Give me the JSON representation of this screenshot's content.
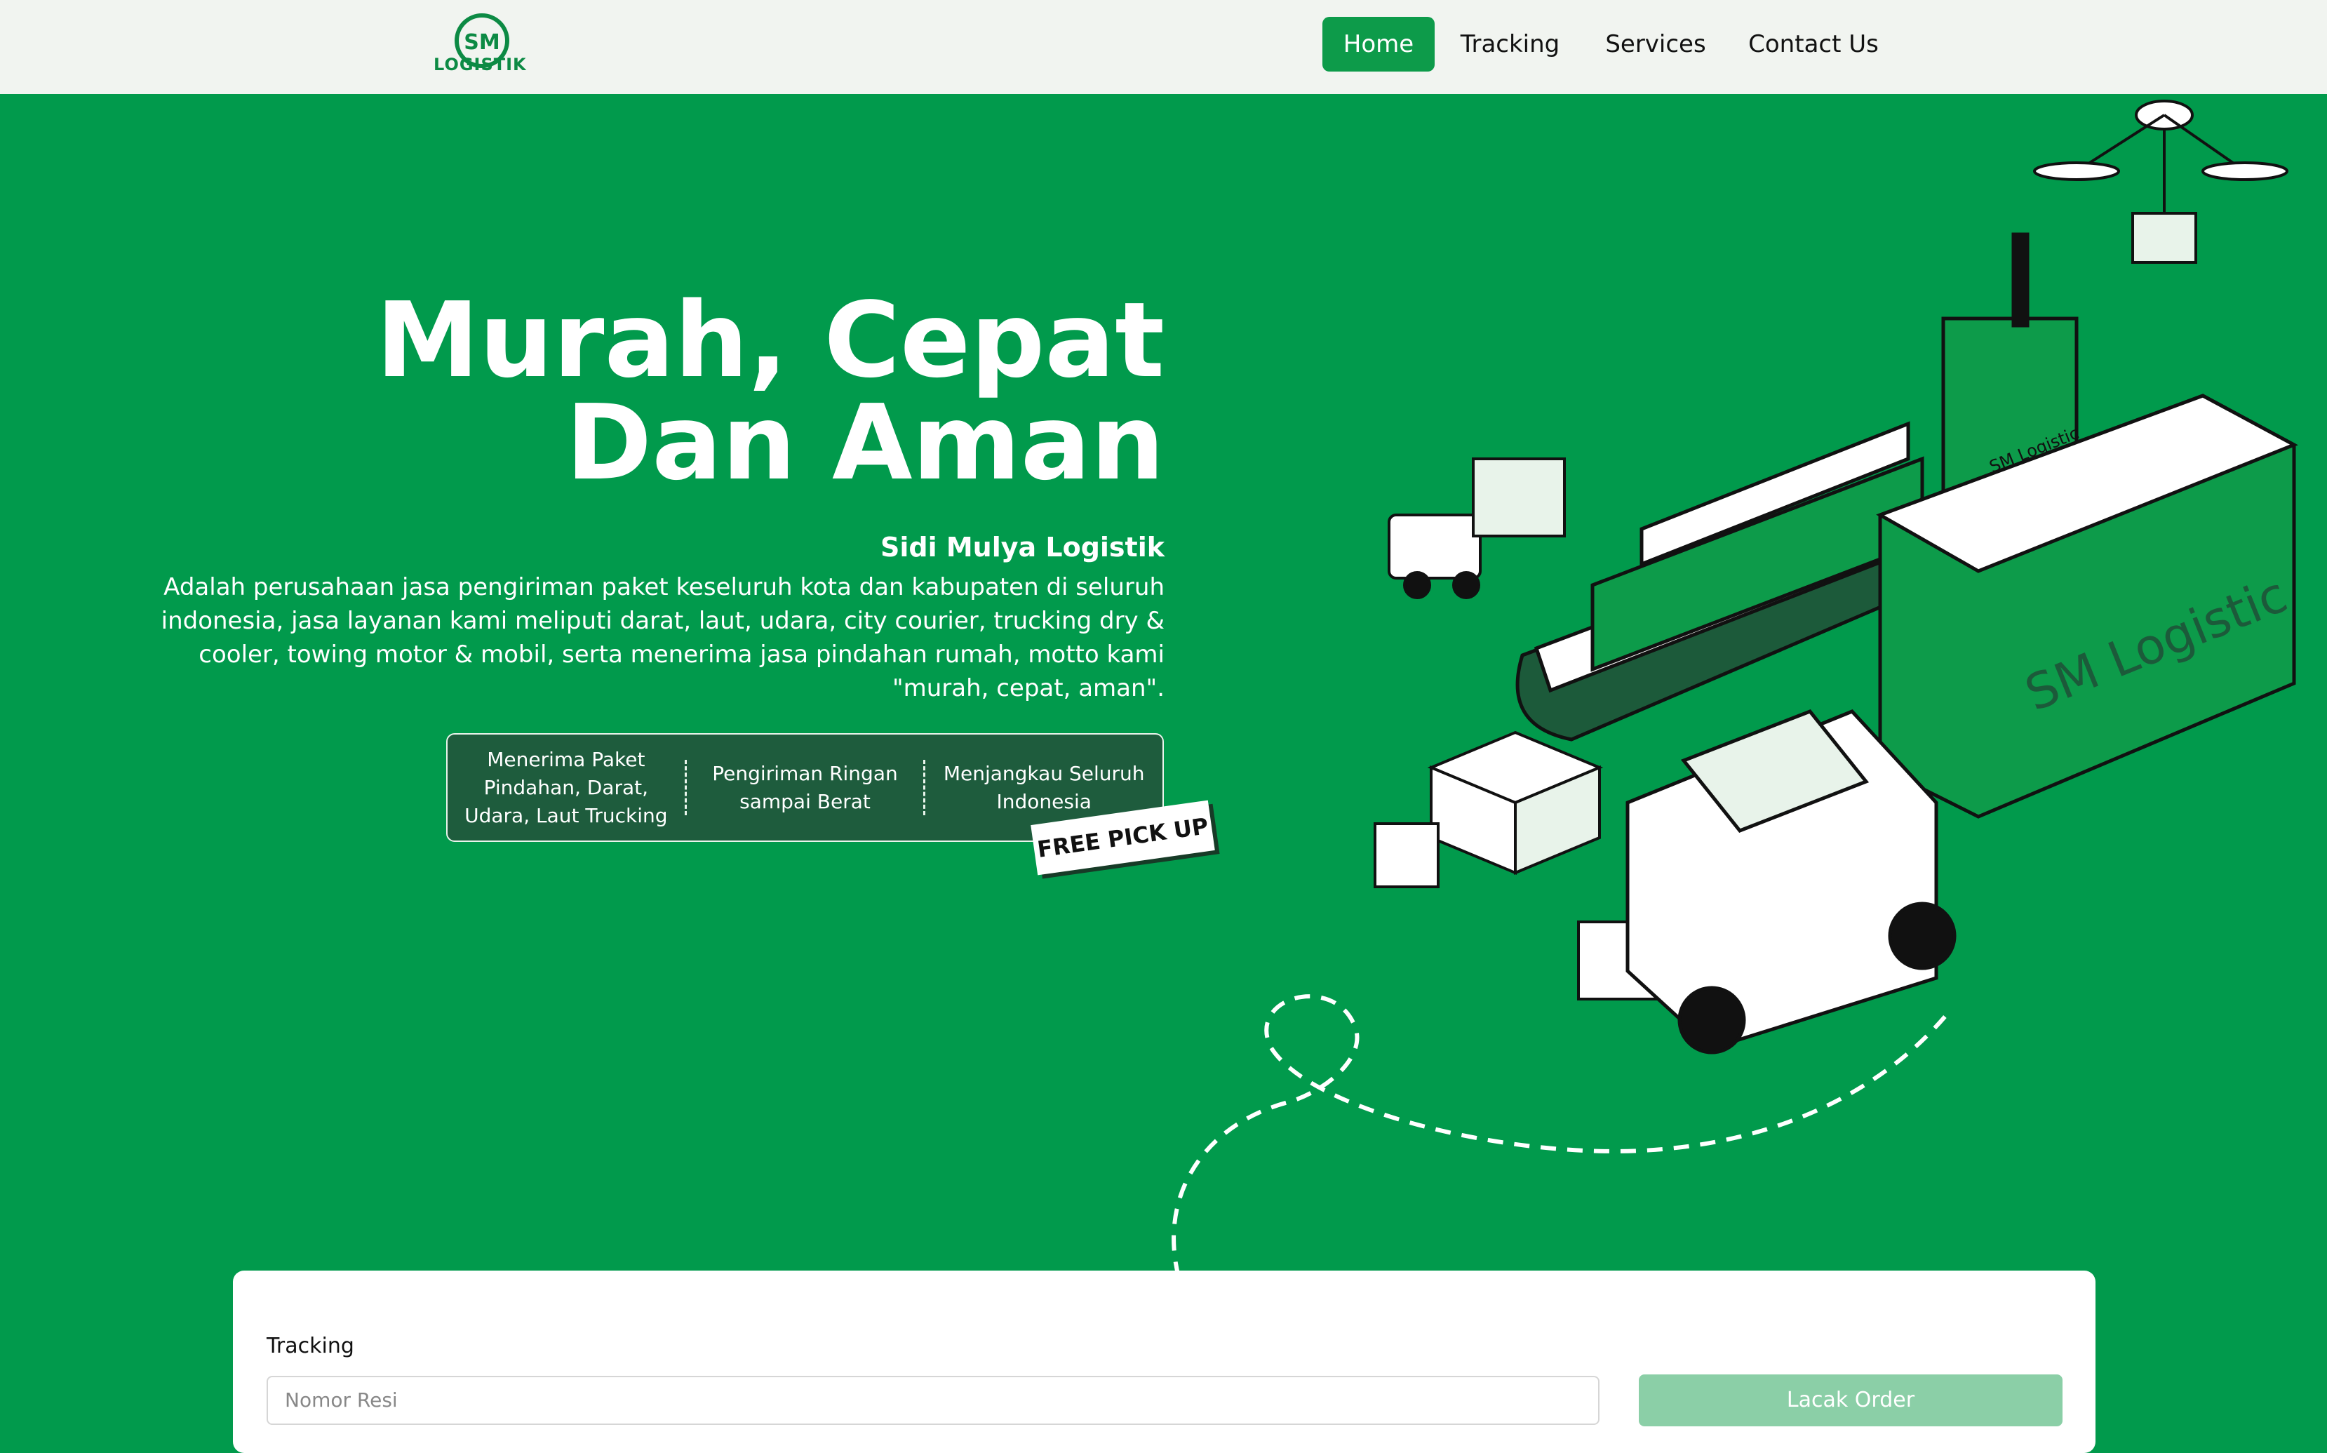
{
  "brand": {
    "logo_initials": "SM",
    "logo_text": "LOGISTIK"
  },
  "nav": {
    "items": [
      {
        "label": "Home",
        "active": true
      },
      {
        "label": "Tracking",
        "active": false
      },
      {
        "label": "Services",
        "active": false
      },
      {
        "label": "Contact Us",
        "active": false
      }
    ]
  },
  "hero": {
    "headline_line1": "Murah, Cepat",
    "headline_line2": "Dan Aman",
    "company": "Sidi Mulya Logistik",
    "description": "Adalah perusahaan jasa pengiriman paket keseluruh kota dan kabupaten di seluruh indonesia, jasa layanan kami meliputi darat, laut, udara, city courier, trucking dry & cooler, towing motor & mobil, serta menerima jasa pindahan rumah, motto kami \"murah, cepat, aman\".",
    "features": [
      "Menerima Paket Pindahan, Darat, Udara, Laut Trucking",
      "Pengiriman Ringan sampai Berat",
      "Menjangkau Seluruh Indonesia"
    ],
    "badge": "FREE PICK UP",
    "truck_label": "SM Logistic",
    "ship_label": "SM Logistic"
  },
  "tracking": {
    "label": "Tracking",
    "placeholder": "Nomor Resi",
    "button": "Lacak Order"
  },
  "colors": {
    "primary": "#019a4c",
    "nav_bg": "#f1f4f0",
    "feature_bg": "#1e5c3d",
    "button_disabled": "#8bcfa7"
  }
}
